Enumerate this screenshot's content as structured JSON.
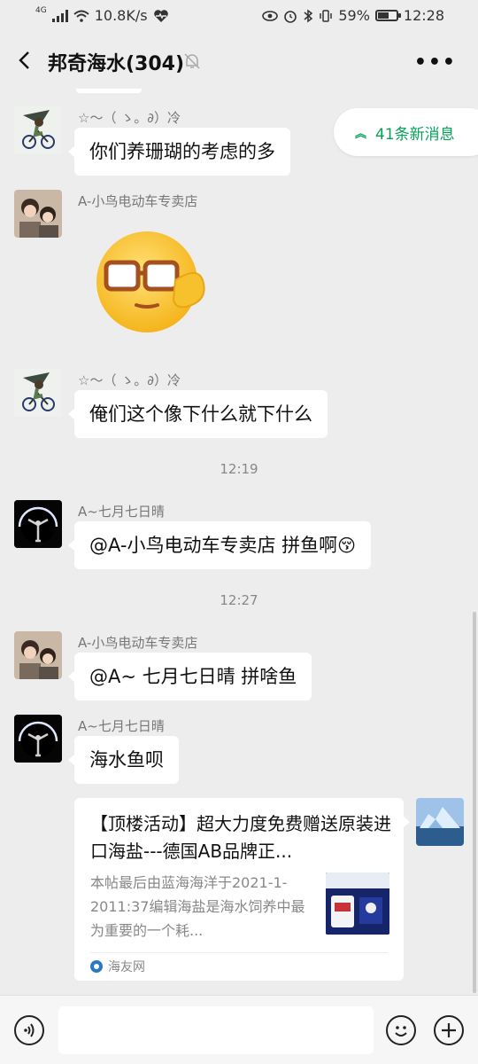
{
  "status_bar": {
    "network": "4G",
    "speed": "10.8K/s",
    "battery": "59%",
    "battery_level": 0.59,
    "time": "12:28"
  },
  "header": {
    "title": "邦奇海水(304)"
  },
  "new_messages": "41条新消息",
  "messages": [
    {
      "sender": "☆～（ ゝ。∂）冷",
      "text": "你们养珊瑚的考虑的多"
    },
    {
      "sender": "A-小鸟电动车专卖店",
      "sticker": "glasses-salute-emoji"
    },
    {
      "sender": "☆～（ ゝ。∂）冷",
      "text": "俺们这个像下什么就下什么"
    },
    {
      "time": "12:19"
    },
    {
      "sender": "A~七月七日晴",
      "text": "@A-小鸟电动车专卖店  拼鱼啊",
      "emoji": "😚"
    },
    {
      "time": "12:27"
    },
    {
      "sender": "A-小鸟电动车专卖店",
      "text": "@A~ 七月七日晴  拼啥鱼"
    },
    {
      "sender": "A~七月七日晴",
      "text": "海水鱼呗"
    },
    {
      "link_card": {
        "title": "【顶楼活动】超大力度免费赠送原装进口海盐---德国AB品牌正...",
        "description": "本帖最后由蓝海海洋于2021-1-2011:37编辑海盐是海水饲养中最为重要的一个耗...",
        "source": "海友网"
      }
    }
  ],
  "colors": {
    "background": "#ededed",
    "bubble": "#ffffff",
    "accent_green": "#07a25a"
  }
}
